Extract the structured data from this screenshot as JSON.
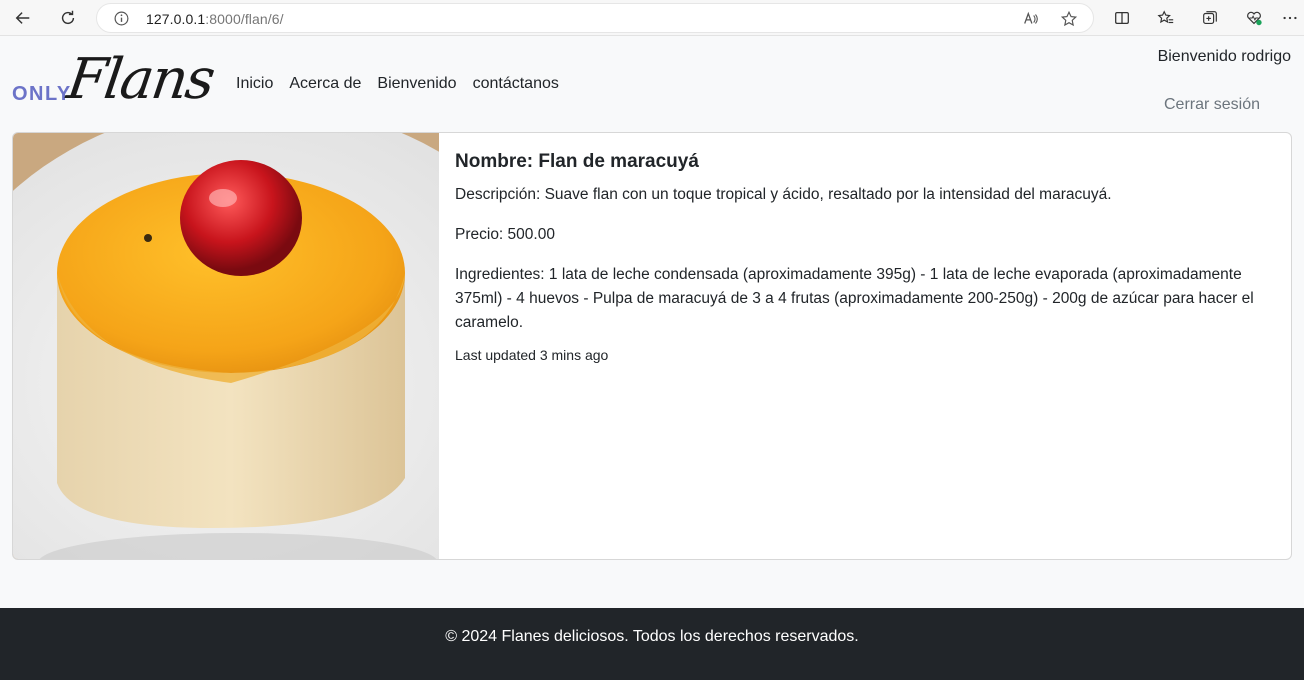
{
  "browser": {
    "url_host": "127.0.0.1",
    "url_path": ":8000/flan/6/",
    "icons": [
      "back-icon",
      "reload-icon",
      "info-icon",
      "read-aloud-icon",
      "favorite-star-icon",
      "split-screen-icon",
      "favorites-icon",
      "collections-icon",
      "browser-essentials-icon",
      "more-icon"
    ]
  },
  "navbar": {
    "logo_small": "ONLY",
    "logo_script": "Flans",
    "links": [
      "Inicio",
      "Acerca de",
      "Bienvenido",
      "contáctanos"
    ],
    "greeting": "Bienvenido rodrigo",
    "logout": "Cerrar sesión"
  },
  "flan": {
    "title": "Nombre: Flan de maracuyá",
    "description": "Descripción: Suave flan con un toque tropical y ácido, resaltado por la intensidad del maracuyá.",
    "price": "Precio: 500.00",
    "ingredients": "Ingredientes: 1 lata de leche condensada (aproximadamente 395g) - 1 lata de leche evaporada (aproximadamente 375ml) - 4 huevos - Pulpa de maracuyá de 3 a 4 frutas (aproximadamente 200-250g) - 200g de azúcar para hacer el caramelo.",
    "updated": "Last updated 3 mins ago"
  },
  "footer": {
    "text": "© 2024 Flanes deliciosos. Todos los derechos reservados."
  },
  "colors": {
    "logo_accent": "#6c73c8",
    "footer_bg": "#212529",
    "page_bg": "#f8f9fa"
  }
}
